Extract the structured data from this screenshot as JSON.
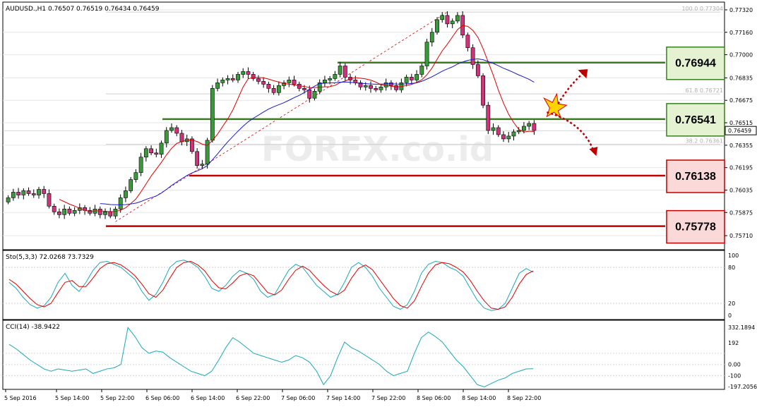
{
  "chart_data": {
    "type": "candlestick",
    "symbol_header": "AUDUSD.,H1  0.76507 0.76519 0.76434 0.76459",
    "current_price": "0.76459",
    "price_ticks": [
      "0.77320",
      "0.77160",
      "0.77000",
      "0.76835",
      "0.76675",
      "0.76515",
      "0.76355",
      "0.76195",
      "0.76035",
      "0.75875",
      "0.75710"
    ],
    "ylim": [
      0.7562,
      0.7736
    ],
    "time_labels": [
      "5 Sep 2016",
      "5 Sep 14:00",
      "5 Sep 22:00",
      "6 Sep 06:00",
      "6 Sep 14:00",
      "6 Sep 22:00",
      "7 Sep 06:00",
      "7 Sep 14:00",
      "7 Sep 22:00",
      "8 Sep 06:00",
      "8 Sep 14:00",
      "8 Sep 22:00"
    ],
    "fib_levels": [
      {
        "label": "100.0  0.77304",
        "value": 0.77304
      },
      {
        "label": "61.8  0.76721",
        "value": 0.76721
      },
      {
        "label": "38.2  0.76361",
        "value": 0.76361
      }
    ],
    "levels": [
      {
        "value": 0.76944,
        "label": "0.76944",
        "kind": "resistance"
      },
      {
        "value": 0.76541,
        "label": "0.76541",
        "kind": "resistance"
      },
      {
        "value": 0.76138,
        "label": "0.76138",
        "kind": "support"
      },
      {
        "value": 0.75778,
        "label": "0.75778",
        "kind": "support"
      }
    ],
    "series": [
      {
        "name": "Price",
        "closes": [
          0.7598,
          0.7602,
          0.76,
          0.7603,
          0.7601,
          0.76,
          0.7604,
          0.7601,
          0.7592,
          0.7588,
          0.7586,
          0.759,
          0.7587,
          0.7589,
          0.7591,
          0.7589,
          0.7587,
          0.759,
          0.7586,
          0.7588,
          0.7585,
          0.759,
          0.7598,
          0.7603,
          0.7611,
          0.7616,
          0.7627,
          0.7633,
          0.763,
          0.7629,
          0.7637,
          0.7646,
          0.7648,
          0.7644,
          0.7638,
          0.764,
          0.7631,
          0.7621,
          0.7622,
          0.7639,
          0.7676,
          0.768,
          0.7682,
          0.7683,
          0.7682,
          0.7686,
          0.7688,
          0.7686,
          0.7683,
          0.7681,
          0.7679,
          0.7676,
          0.7673,
          0.7678,
          0.768,
          0.7682,
          0.7679,
          0.7676,
          0.7675,
          0.7669,
          0.7674,
          0.768,
          0.7682,
          0.7683,
          0.7686,
          0.7692,
          0.7684,
          0.7682,
          0.768,
          0.7677,
          0.7678,
          0.7676,
          0.7675,
          0.7677,
          0.768,
          0.7678,
          0.7675,
          0.768,
          0.7684,
          0.7682,
          0.7686,
          0.7692,
          0.7709,
          0.7716,
          0.7725,
          0.7728,
          0.7722,
          0.7724,
          0.7728,
          0.7714,
          0.7705,
          0.7693,
          0.7685,
          0.7664,
          0.7646,
          0.7648,
          0.7643,
          0.764,
          0.7642,
          0.7645,
          0.7646,
          0.7649,
          0.7651,
          0.7646
        ]
      }
    ],
    "ma_fast_name": "MA red",
    "ma_slow_name": "MA blue",
    "stochastic": {
      "header": "Sto(5,3,3) 72.0268 73.7329",
      "ticks": [
        "100",
        "80",
        "20",
        "0"
      ],
      "main": [
        55,
        45,
        30,
        18,
        12,
        16,
        30,
        55,
        70,
        50,
        40,
        55,
        75,
        88,
        90,
        85,
        80,
        70,
        60,
        40,
        25,
        35,
        55,
        80,
        90,
        92,
        88,
        80,
        65,
        45,
        40,
        50,
        65,
        75,
        70,
        60,
        40,
        30,
        35,
        55,
        75,
        85,
        80,
        65,
        50,
        40,
        30,
        35,
        55,
        80,
        88,
        80,
        65,
        45,
        30,
        15,
        10,
        18,
        40,
        70,
        85,
        90,
        88,
        80,
        75,
        65,
        45,
        25,
        12,
        8,
        10,
        20,
        45,
        70,
        78,
        72
      ],
      "signal": [
        60,
        52,
        40,
        28,
        18,
        14,
        20,
        38,
        55,
        58,
        48,
        48,
        62,
        78,
        86,
        88,
        84,
        76,
        66,
        52,
        36,
        30,
        42,
        62,
        80,
        88,
        90,
        84,
        74,
        58,
        46,
        44,
        54,
        66,
        70,
        66,
        52,
        38,
        34,
        42,
        60,
        75,
        82,
        75,
        62,
        50,
        40,
        34,
        42,
        62,
        78,
        84,
        76,
        60,
        44,
        28,
        16,
        12,
        24,
        48,
        70,
        84,
        88,
        86,
        80,
        72,
        58,
        40,
        24,
        12,
        10,
        14,
        30,
        52,
        68,
        74
      ]
    },
    "cci": {
      "header": "CCI(14) -38.9422",
      "ticks": [
        "332.1894",
        "192",
        "0.00",
        "-100",
        "-197.2056"
      ],
      "values": [
        180,
        140,
        90,
        40,
        0,
        -40,
        -60,
        -40,
        -50,
        -60,
        -50,
        -40,
        -80,
        -60,
        -40,
        -30,
        0,
        330,
        250,
        150,
        100,
        120,
        110,
        60,
        20,
        -20,
        -60,
        -80,
        -100,
        -60,
        40,
        150,
        240,
        200,
        150,
        100,
        80,
        60,
        40,
        20,
        40,
        80,
        60,
        20,
        -60,
        -180,
        -100,
        60,
        200,
        150,
        120,
        80,
        40,
        0,
        -60,
        -100,
        -80,
        -60,
        100,
        240,
        290,
        250,
        200,
        120,
        40,
        -20,
        -100,
        -180,
        -200,
        -170,
        -140,
        -120,
        -80,
        -60,
        -40,
        -38
      ]
    },
    "watermark": "FOREX.co.id"
  }
}
